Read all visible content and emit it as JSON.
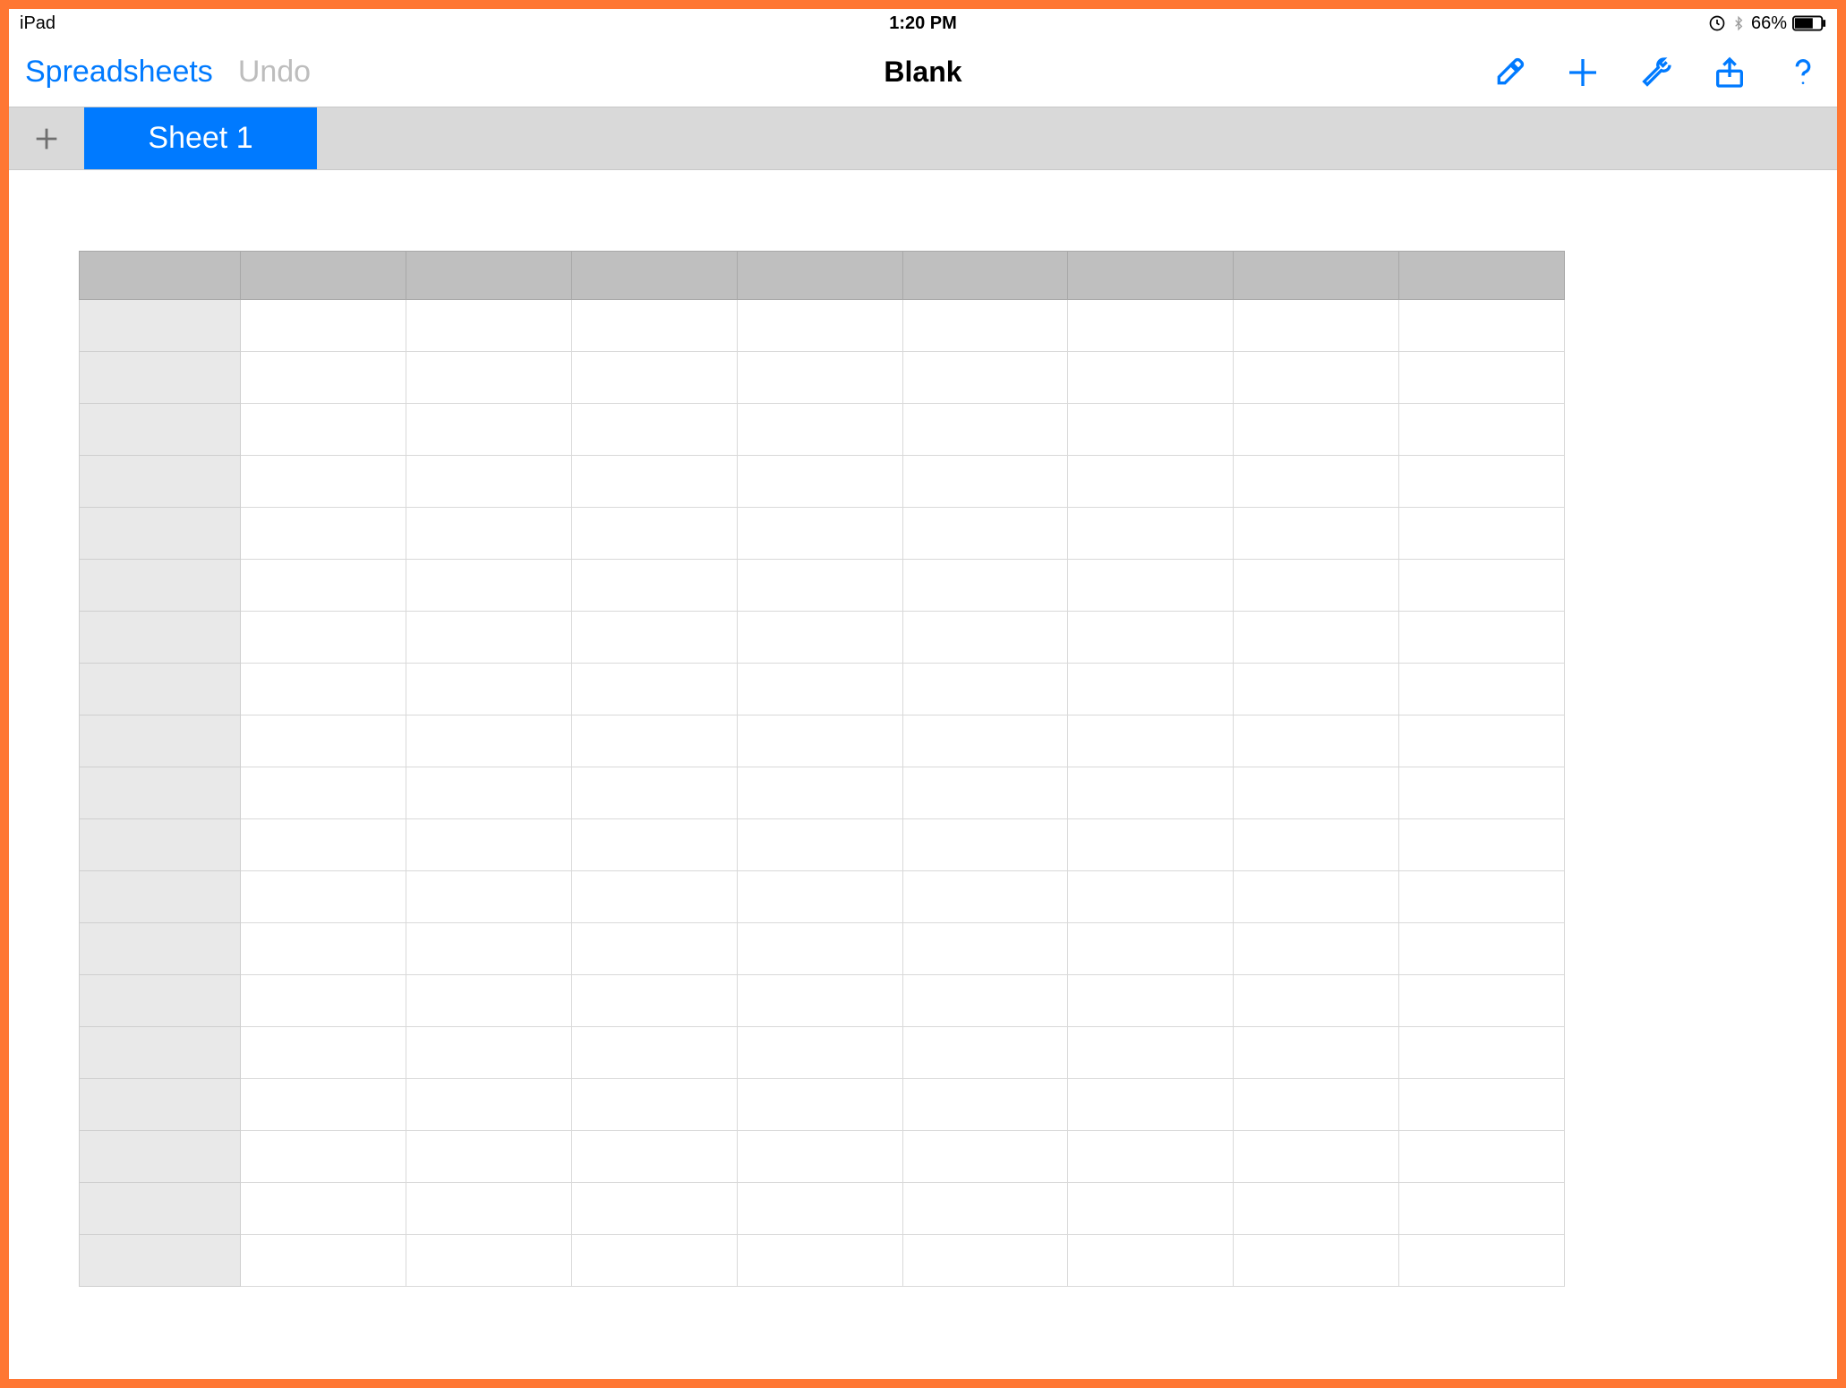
{
  "status": {
    "device": "iPad",
    "time": "1:20 PM",
    "battery_pct": "66%",
    "icons": {
      "rotation_lock": "rotation-lock-icon",
      "bluetooth": "bluetooth-icon",
      "battery": "battery-icon"
    }
  },
  "toolbar": {
    "back_label": "Spreadsheets",
    "undo_label": "Undo",
    "title": "Blank",
    "icons": {
      "format": "paintbrush-icon",
      "add": "plus-icon",
      "tools": "wrench-icon",
      "share": "share-icon",
      "help": "help-icon"
    }
  },
  "tabs": {
    "add_icon": "plus-icon",
    "items": [
      {
        "label": "Sheet 1",
        "active": true
      }
    ]
  },
  "sheet": {
    "columns": 9,
    "rows": 19,
    "column_headers": [
      "",
      "",
      "",
      "",
      "",
      "",
      "",
      "",
      ""
    ],
    "row_headers": [
      "",
      "",
      "",
      "",
      "",
      "",
      "",
      "",
      "",
      "",
      "",
      "",
      "",
      "",
      "",
      "",
      "",
      "",
      ""
    ],
    "cells": []
  },
  "colors": {
    "accent": "#007aff",
    "frame": "#ff7733",
    "tabbar_bg": "#d9d9d9",
    "header_bg": "#bfbfbf",
    "rowhead_bg": "#e9e9e9"
  }
}
